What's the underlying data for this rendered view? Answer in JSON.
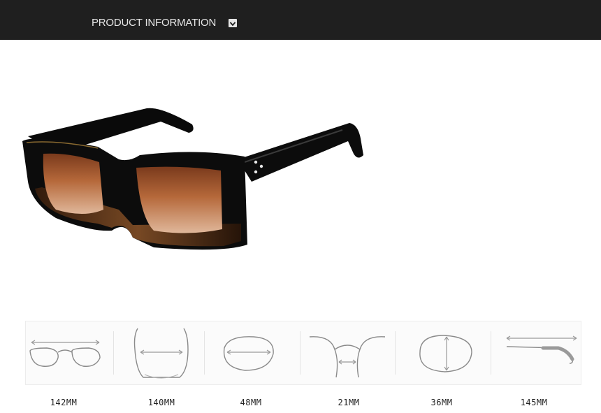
{
  "header": {
    "title": "PRODUCT INFORMATION"
  },
  "dimensions": [
    {
      "icon": "frame-width-icon",
      "value": "142MM"
    },
    {
      "icon": "lens-span-icon",
      "value": "140MM"
    },
    {
      "icon": "lens-width-icon",
      "value": "48MM"
    },
    {
      "icon": "bridge-width-icon",
      "value": "21MM"
    },
    {
      "icon": "lens-height-icon",
      "value": "36MM"
    },
    {
      "icon": "temple-length-icon",
      "value": "145MM"
    }
  ],
  "colors": {
    "header_bg": "#1f1f1f",
    "frame_black": "#0c0c0c",
    "lens_brown": "#b5683a",
    "tortoise": "#6b3d1f"
  }
}
